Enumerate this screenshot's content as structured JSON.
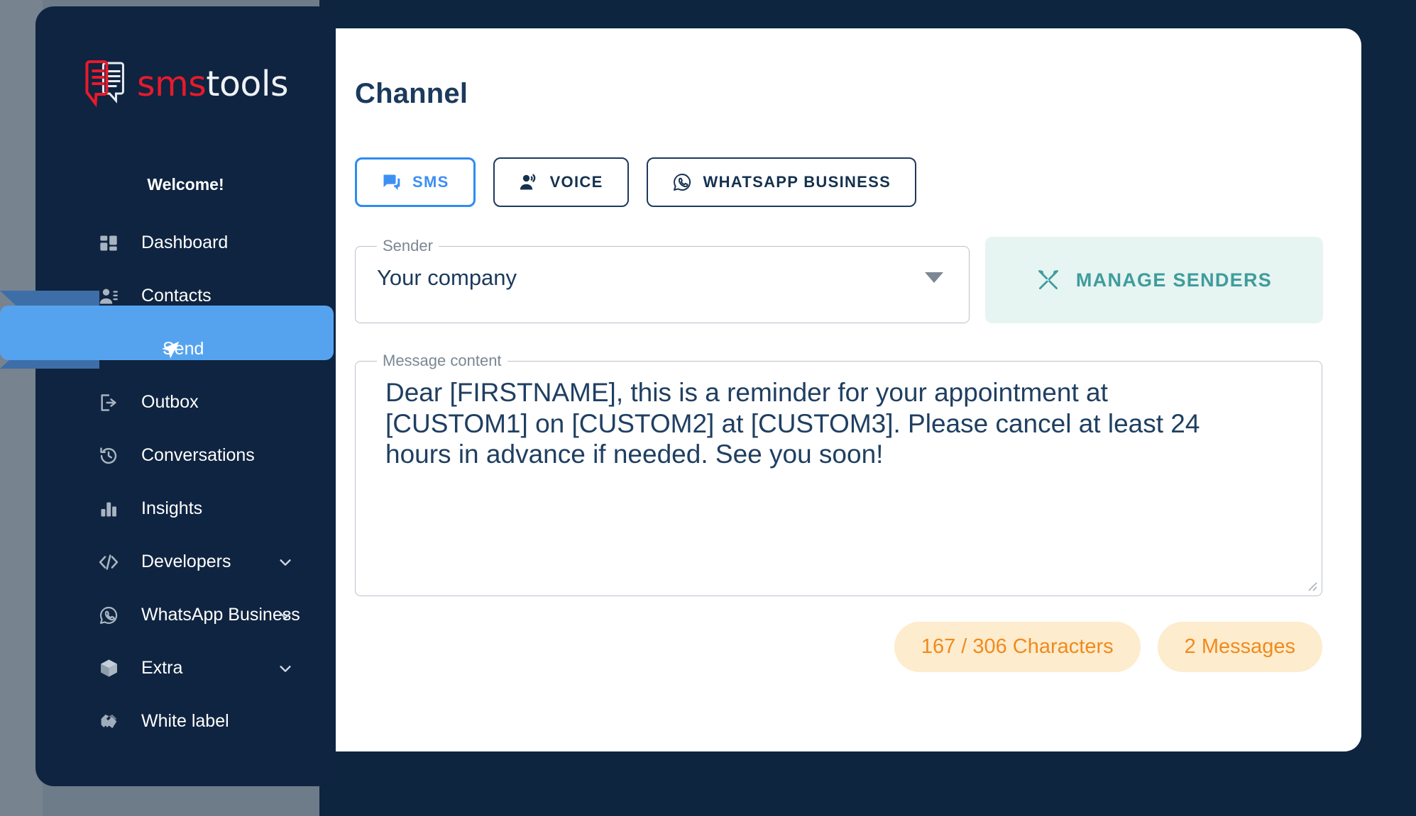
{
  "brand": {
    "logo_sms": "sms",
    "logo_tools": "tools",
    "logo_icon": "sms-chat-bubbles-icon"
  },
  "sidebar": {
    "welcome": "Welcome!",
    "items": [
      {
        "label": "Dashboard",
        "icon": "dashboard-grid-icon",
        "expandable": false,
        "active": false
      },
      {
        "label": "Contacts",
        "icon": "contacts-person-icon",
        "expandable": false,
        "active": false
      },
      {
        "label": "Send",
        "icon": "send-paper-plane-icon",
        "expandable": false,
        "active": true
      },
      {
        "label": "Outbox",
        "icon": "outbox-exit-arrow-icon",
        "expandable": false,
        "active": false
      },
      {
        "label": "Conversations",
        "icon": "history-clock-icon",
        "expandable": false,
        "active": false
      },
      {
        "label": "Insights",
        "icon": "bar-chart-icon",
        "expandable": false,
        "active": false
      },
      {
        "label": "Developers",
        "icon": "code-brackets-icon",
        "expandable": true,
        "active": false
      },
      {
        "label": "WhatsApp Business",
        "icon": "whatsapp-icon",
        "expandable": true,
        "active": false
      },
      {
        "label": "Extra",
        "icon": "box-cube-icon",
        "expandable": true,
        "active": false
      },
      {
        "label": "White label",
        "icon": "handshake-icon",
        "expandable": false,
        "active": false
      }
    ]
  },
  "main": {
    "page_title": "Channel",
    "tabs": [
      {
        "label": "SMS",
        "icon": "chat-bubbles-icon",
        "active": true
      },
      {
        "label": "VOICE",
        "icon": "voice-person-sound-icon",
        "active": false
      },
      {
        "label": "WHATSAPP BUSINESS",
        "icon": "whatsapp-icon",
        "active": false
      }
    ],
    "sender": {
      "legend": "Sender",
      "value": "Your company",
      "dropdown_icon": "chevron-down-filled-icon"
    },
    "manage_senders": {
      "label": "MANAGE SENDERS",
      "icon": "tools-cross-icon"
    },
    "message": {
      "legend": "Message content",
      "value": "Dear [FIRSTNAME], this is a reminder for your appointment at [CUSTOM1] on [CUSTOM2] at [CUSTOM3]. Please cancel at least 24 hours in advance if needed. See you soon!",
      "placeholder": "Message content"
    },
    "badges": [
      {
        "label": "167 / 306 Characters"
      },
      {
        "label": "2 Messages"
      }
    ]
  },
  "colors": {
    "background_navy": "#0d253f",
    "sidebar_navy": "#0f2440",
    "accent_blue": "#55a3ef",
    "ribbon_blue": "#3d6ea8",
    "brand_red": "#e8192c",
    "tab_active_blue": "#3d8ff3",
    "teal": "#3f9c9c",
    "teal_bg": "#e6f4f2",
    "badge_orange": "#f08a1e",
    "badge_bg": "#fdeccd",
    "text_navy": "#1b3a5c"
  }
}
